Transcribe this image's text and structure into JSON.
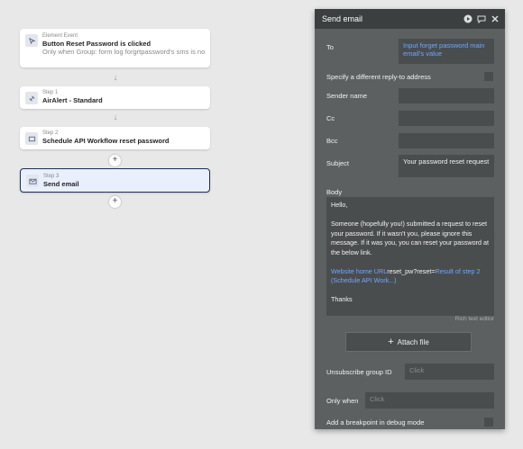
{
  "workflow": {
    "event": {
      "caption": "Element Event",
      "title": "Button Reset Password is clicked",
      "condition": "Only when Group: form log forgrtpassword's sms is no"
    },
    "steps": [
      {
        "caption": "Step 1",
        "title": "AirAlert - Standard"
      },
      {
        "caption": "Step 2",
        "title": "Schedule API Workflow reset password"
      },
      {
        "caption": "Step 3",
        "title": "Send email"
      }
    ],
    "arrow": "↓",
    "add": "+"
  },
  "panel": {
    "title": "Send email",
    "icons": [
      "play-icon",
      "comment-icon",
      "close-icon"
    ],
    "fields": {
      "to_label": "To",
      "to_value": "Input forget password main email's value",
      "reply_label": "Specify a different reply-to address",
      "sender_label": "Sender name",
      "cc_label": "Cc",
      "bcc_label": "Bcc",
      "subject_label": "Subject",
      "subject_value": "Your password reset request",
      "body_label": "Body",
      "unsub_label": "Unsubscribe group ID",
      "unsub_placeholder": "Click",
      "only_when_label": "Only when",
      "only_when_placeholder": "Click",
      "breakpoint_label": "Add a breakpoint in debug mode"
    },
    "body": {
      "greeting": "Hello,",
      "paragraph": "Someone (hopefully you!) submitted a request to reset your password. If it wasn't you, please ignore this message. If it was you, you can reset your password at the below link.",
      "link_part1": "Website home URL",
      "link_part2": "reset_pw?reset=",
      "link_part3": "Result of step 2 (Schedule API Work...)",
      "closing": "Thanks"
    },
    "rich_text": "Rich text editor",
    "attach_label": "Attach file"
  }
}
